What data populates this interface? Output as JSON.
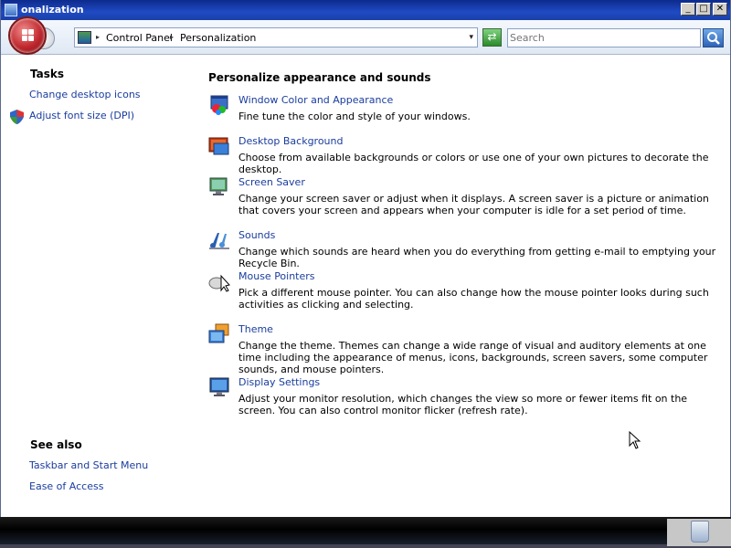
{
  "window": {
    "title": "Personalization",
    "title_visible": "onalization",
    "controls": {
      "minimize": "_",
      "maximize": "□",
      "close": "✕"
    }
  },
  "address_bar": {
    "breadcrumbs": [
      "Control Panel",
      "Personalization"
    ],
    "separator": "▸",
    "dropdown": "▾",
    "refresh_glyph": "⇄",
    "search_placeholder": "Search"
  },
  "left_pane": {
    "tasks_heading": "Tasks",
    "tasks": [
      "Change desktop icons",
      "Adjust font size (DPI)"
    ],
    "see_also_heading": "See also",
    "see_also": [
      "Taskbar and Start Menu",
      "Ease of Access"
    ]
  },
  "main": {
    "heading": "Personalize appearance and sounds",
    "items": [
      {
        "title": "Window Color and Appearance",
        "description": "Fine tune the color and style of your windows.",
        "icon": "window-color-icon"
      },
      {
        "title": "Desktop Background",
        "description": "Choose from available backgrounds or colors or use one of your own pictures to decorate the desktop.",
        "icon": "desktop-background-icon"
      },
      {
        "title": "Screen Saver",
        "description": "Change your screen saver or adjust when it displays. A screen saver is a picture or animation that covers your screen and appears when your computer is idle for a set period of time.",
        "icon": "screen-saver-icon"
      },
      {
        "title": "Sounds",
        "description": "Change which sounds are heard when you do everything from getting e-mail to emptying your Recycle Bin.",
        "icon": "sounds-icon"
      },
      {
        "title": "Mouse Pointers",
        "description": "Pick a different mouse pointer. You can also change how the mouse pointer looks during such activities as clicking and selecting.",
        "icon": "mouse-pointers-icon"
      },
      {
        "title": "Theme",
        "description": "Change the theme. Themes can change a wide range of visual and auditory elements at one time including the appearance of menus, icons, backgrounds, screen savers, some computer sounds, and mouse pointers.",
        "icon": "theme-icon"
      },
      {
        "title": "Display Settings",
        "description": "Adjust your monitor resolution, which changes the view so more or fewer items fit on the screen. You can also control monitor flicker (refresh rate).",
        "icon": "display-settings-icon"
      }
    ]
  },
  "colors": {
    "link": "#1a3d9e",
    "titlebar": "#1f4bc4",
    "orb": "#c0272d"
  }
}
